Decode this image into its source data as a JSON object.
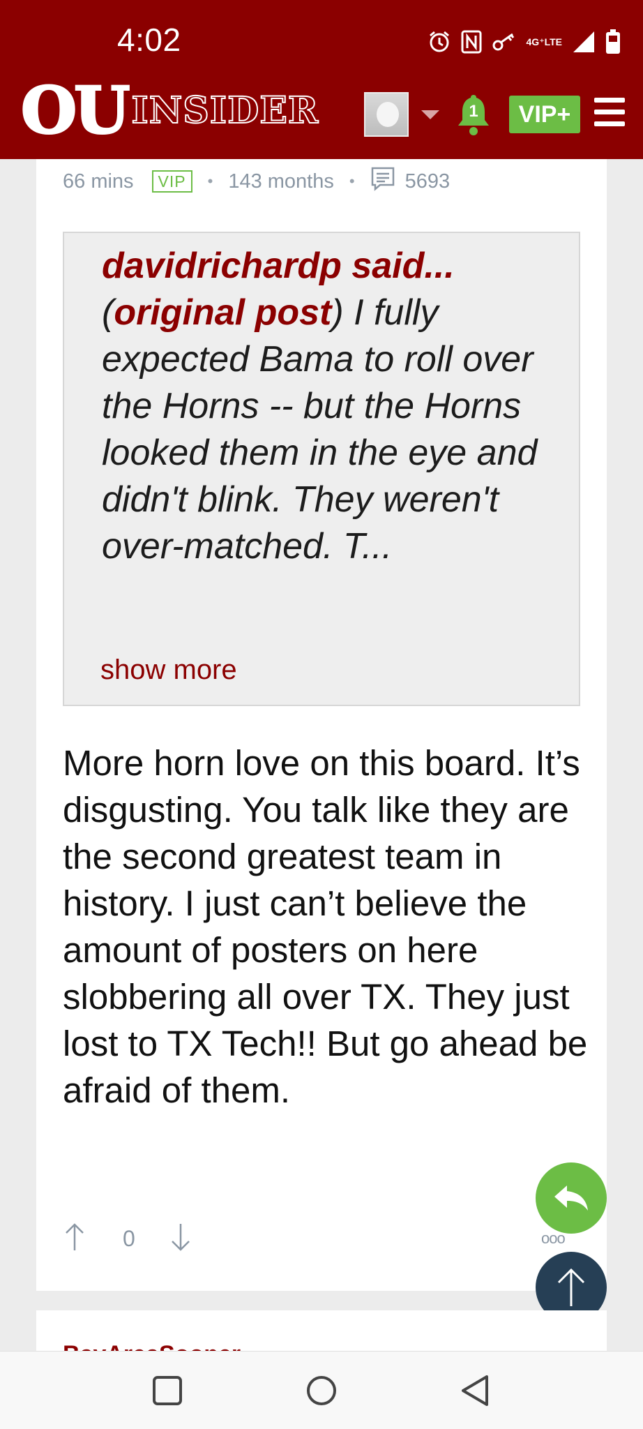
{
  "status_bar": {
    "time": "4:02",
    "network_top": "4G⁺",
    "network_bottom": "LTE"
  },
  "app_bar": {
    "logo_ou": "OU",
    "logo_insider": "INSIDER",
    "notification_count": "1",
    "vip_button": "VIP+"
  },
  "post_meta": {
    "time_ago": "66 mins",
    "badge": "VIP",
    "tenure": "143 months",
    "post_count": "5693"
  },
  "quote": {
    "author": "davidrichardp said...",
    "open_paren": "(",
    "original_post_link": "original post",
    "text": ") I fully expected Bama to roll over the Horns -- but the Horns looked them in the eye and didn't blink. They weren't over-matched. T...",
    "show_more": "show more"
  },
  "post": {
    "body": "More horn love on this board. It’s disgusting. You talk like they are the second greatest team in history. I just can’t believe the amount of posters on here slobbering all over TX. They just lost to TX Tech!! But go ahead be afraid of them."
  },
  "votes": {
    "count": "0"
  },
  "next_post": {
    "author": "BayAreaSooner"
  },
  "colors": {
    "brand": "#8b0000",
    "vip_green": "#6cbd45",
    "scroll_top_fab": "#263f55"
  }
}
